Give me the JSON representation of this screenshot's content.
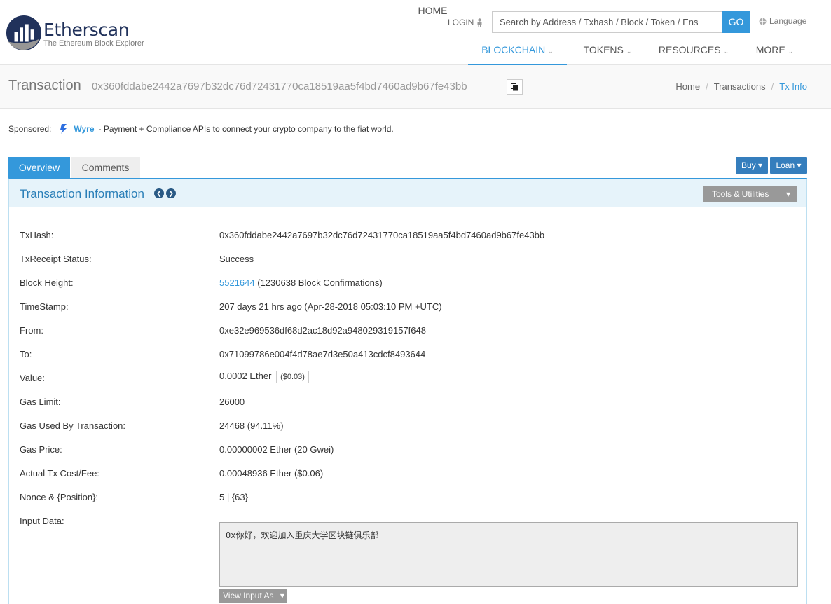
{
  "header": {
    "brand": "Etherscan",
    "tagline": "The Ethereum Block Explorer",
    "login": "LOGIN",
    "search_placeholder": "Search by Address / Txhash / Block / Token / Ens",
    "go": "GO",
    "language": "Language",
    "nav": [
      {
        "label": "HOME",
        "caret": false
      },
      {
        "label": "BLOCKCHAIN",
        "caret": true,
        "active": true
      },
      {
        "label": "TOKENS",
        "caret": true
      },
      {
        "label": "RESOURCES",
        "caret": true
      },
      {
        "label": "MORE",
        "caret": true
      }
    ]
  },
  "title": {
    "heading": "Transaction",
    "hash": "0x360fddabe2442a7697b32dc76d72431770ca18519aa5f4bd7460ad9b67fe43bb",
    "breadcrumb": [
      "Home",
      "Transactions",
      "Tx Info"
    ]
  },
  "sponsored": {
    "label": "Sponsored:",
    "name": "Wyre",
    "text": "- Payment + Compliance APIs to connect your crypto company to the fiat world."
  },
  "tabs": [
    "Overview",
    "Comments"
  ],
  "buttons": {
    "buy": "Buy",
    "loan": "Loan",
    "tools": "Tools & Utilities",
    "view_input": "View Input As"
  },
  "panel_title": "Transaction Information",
  "details": {
    "txhash_label": "TxHash:",
    "txhash": "0x360fddabe2442a7697b32dc76d72431770ca18519aa5f4bd7460ad9b67fe43bb",
    "status_label": "TxReceipt Status:",
    "status": "Success",
    "block_label": "Block Height:",
    "block": "5521644",
    "confirmations": "(1230638 Block Confirmations)",
    "timestamp_label": "TimeStamp:",
    "timestamp": "207 days 21 hrs ago (Apr-28-2018 05:03:10 PM +UTC)",
    "from_label": "From:",
    "from": "0xe32e969536df68d2ac18d92a948029319157f648",
    "to_label": "To:",
    "to": "0x71099786e004f4d78ae7d3e50a413cdcf8493644",
    "value_label": "Value:",
    "value": "0.0002 Ether",
    "value_usd": "($0.03)",
    "gas_limit_label": "Gas Limit:",
    "gas_limit": "26000",
    "gas_used_label": "Gas Used By Transaction:",
    "gas_used": "24468 (94.11%)",
    "gas_price_label": "Gas Price:",
    "gas_price": "0.00000002 Ether (20 Gwei)",
    "fee_label": "Actual Tx Cost/Fee:",
    "fee": "0.00048936 Ether ($0.06)",
    "nonce_label": "Nonce & {Position}:",
    "nonce": "5 | {63}",
    "input_label": "Input Data:",
    "input": "0x你好，欢迎加入重庆大学区块链俱乐部"
  }
}
